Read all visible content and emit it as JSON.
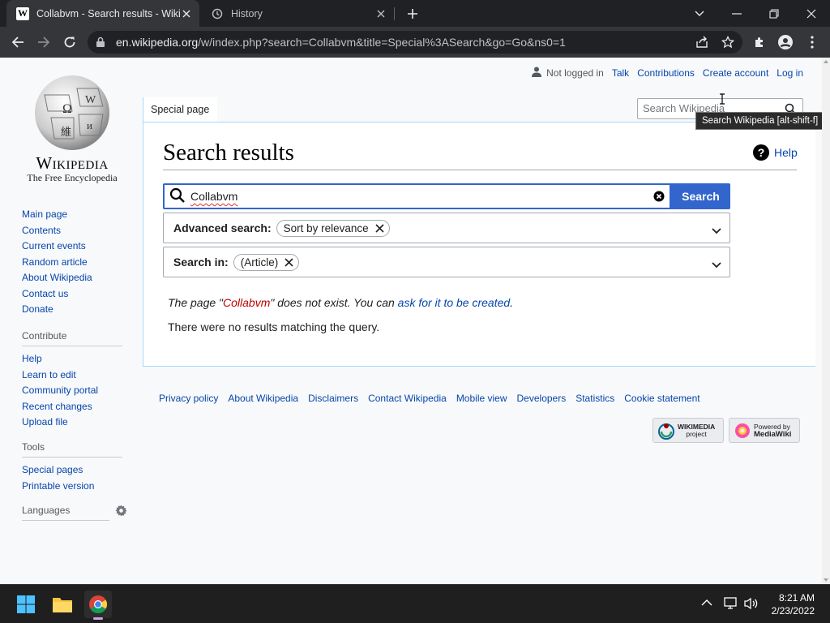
{
  "browser": {
    "tabs": [
      {
        "title": "Collabvm - Search results - Wikip",
        "active": true
      },
      {
        "title": "History",
        "active": false
      }
    ],
    "url_host": "en.wikipedia.org",
    "url_path": "/w/index.php?search=Collabvm&title=Special%3ASearch&go=Go&ns0=1"
  },
  "logo": {
    "wordmark": "Wikipedia",
    "tagline": "The Free Encyclopedia"
  },
  "sidebar": {
    "main": [
      "Main page",
      "Contents",
      "Current events",
      "Random article",
      "About Wikipedia",
      "Contact us",
      "Donate"
    ],
    "contribute_heading": "Contribute",
    "contribute": [
      "Help",
      "Learn to edit",
      "Community portal",
      "Recent changes",
      "Upload file"
    ],
    "tools_heading": "Tools",
    "tools": [
      "Special pages",
      "Printable version"
    ],
    "languages_heading": "Languages"
  },
  "personal": {
    "not_logged_in": "Not logged in",
    "talk": "Talk",
    "contributions": "Contributions",
    "create_account": "Create account",
    "log_in": "Log in"
  },
  "page_tab": "Special page",
  "search_box": {
    "placeholder": "Search Wikipedia",
    "tooltip": "Search Wikipedia [alt-shift-f]"
  },
  "heading": "Search results",
  "help": "Help",
  "search_form": {
    "value": "Collabvm",
    "button": "Search"
  },
  "advanced": {
    "label": "Advanced search:",
    "chip": "Sort by relevance"
  },
  "search_in": {
    "label": "Search in:",
    "chip": "(Article)"
  },
  "message": {
    "prefix": "The page \"",
    "title": "Collabvm",
    "middle": "\" does not exist. You can ",
    "link": "ask for it to be created",
    "suffix": "."
  },
  "no_results": "There were no results matching the query.",
  "footer": [
    "Privacy policy",
    "About Wikipedia",
    "Disclaimers",
    "Contact Wikipedia",
    "Mobile view",
    "Developers",
    "Statistics",
    "Cookie statement"
  ],
  "badges": {
    "wikimedia_top": "WIKIMEDIA",
    "wikimedia_bottom": "project",
    "mediawiki_top": "Powered by",
    "mediawiki_bottom": "MediaWiki"
  },
  "clock": {
    "time": "8:21 AM",
    "date": "2/23/2022"
  },
  "colors": {
    "link": "#0645ad",
    "accent": "#3366cc",
    "redlink": "#ba0000"
  }
}
